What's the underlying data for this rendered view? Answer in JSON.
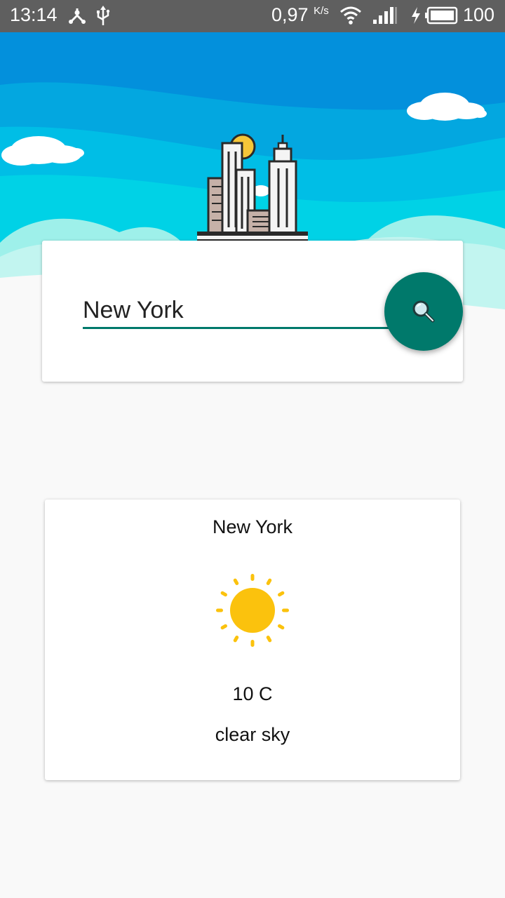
{
  "status_bar": {
    "time": "13:14",
    "network_speed": "0,97",
    "network_unit": "K/s",
    "battery": "100",
    "icons": [
      "share-icon",
      "usb-icon",
      "wifi-icon",
      "signal-icon",
      "charging-icon",
      "battery-icon"
    ]
  },
  "search": {
    "value": "New York",
    "button_icon": "search-icon",
    "accent_color": "#00796b"
  },
  "weather": {
    "city": "New York",
    "icon": "sun-icon",
    "temperature": "10 C",
    "description": "clear sky"
  },
  "header": {
    "illustration": "city-skyline-icon",
    "sky_colors": [
      "#0390dc",
      "#00c6e8",
      "#b4f3ee"
    ]
  }
}
